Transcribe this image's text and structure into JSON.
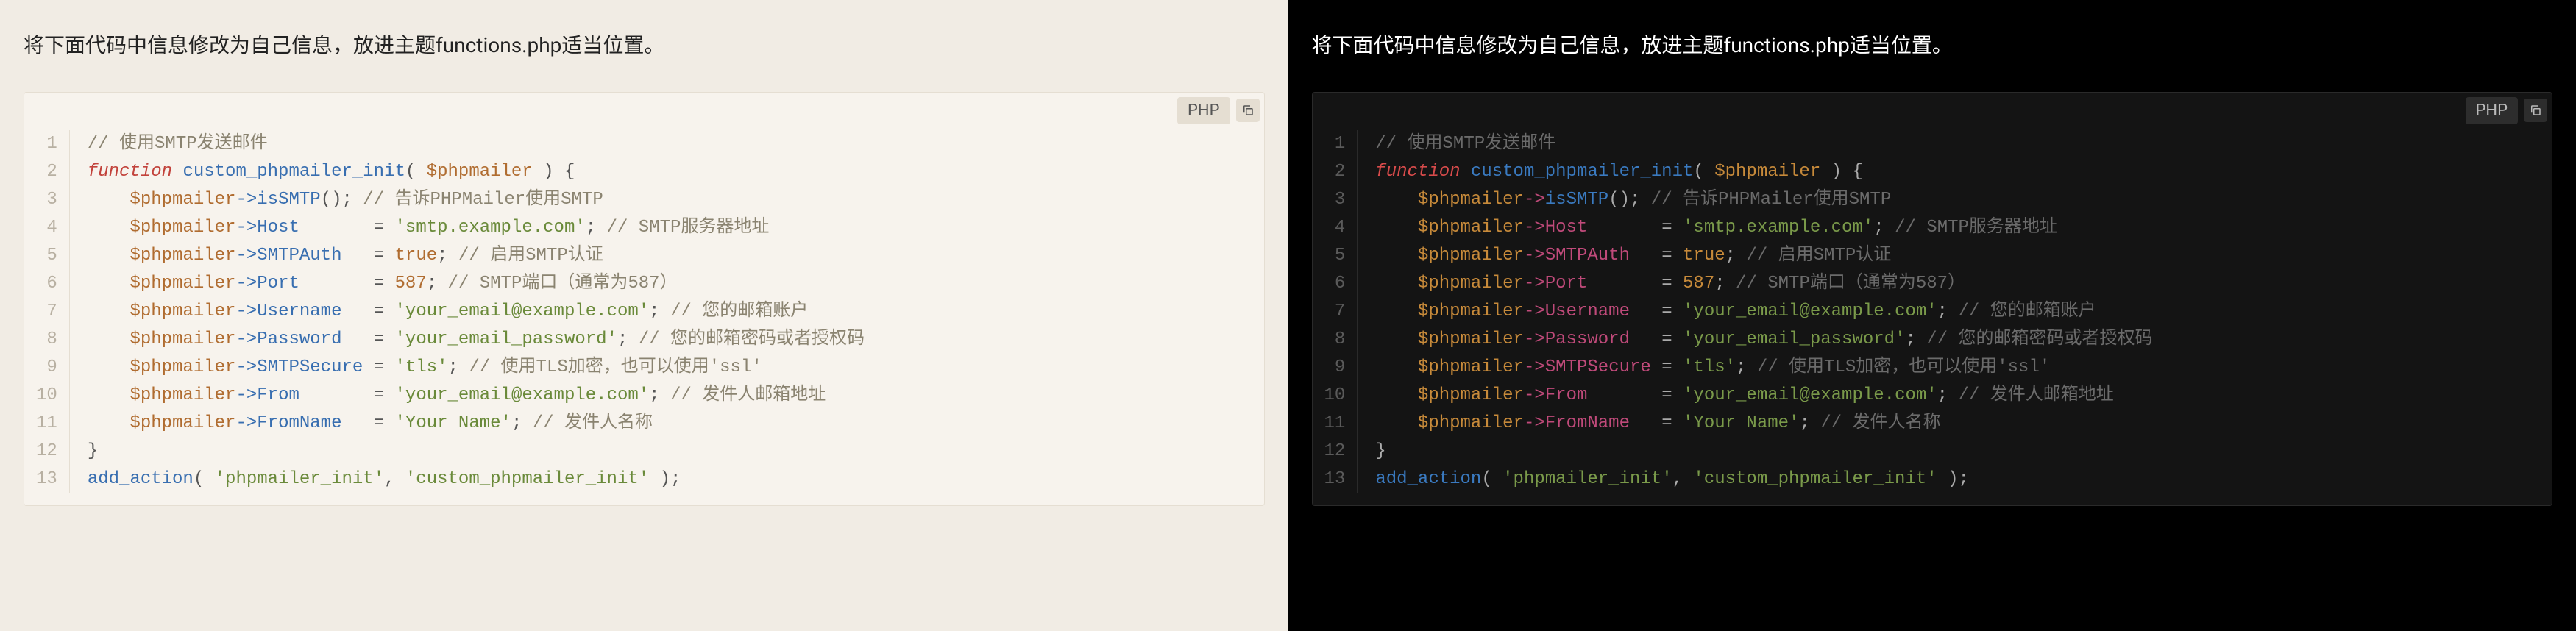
{
  "instruction": "将下面代码中信息修改为自己信息，放进主题functions.php适当位置。",
  "language_badge": "PHP",
  "copy_label": "copy",
  "code": {
    "line_count": 13,
    "tokens": [
      [
        {
          "t": "// 使用SMTP发送邮件",
          "c": "c-comment"
        }
      ],
      [
        {
          "t": "function",
          "c": "c-keyword"
        },
        {
          "t": " "
        },
        {
          "t": "custom_phpmailer_init",
          "c": "c-funcdef"
        },
        {
          "t": "( ",
          "c": "c-punct"
        },
        {
          "t": "$phpmailer",
          "c": "c-var"
        },
        {
          "t": " ) {",
          "c": "c-punct"
        }
      ],
      [
        {
          "t": "    "
        },
        {
          "t": "$phpmailer",
          "c": "c-var"
        },
        {
          "t": "->",
          "c": "c-arrow"
        },
        {
          "t": "isSMTP",
          "c": "c-funccall"
        },
        {
          "t": "(); ",
          "c": "c-punct"
        },
        {
          "t": "// 告诉PHPMailer使用SMTP",
          "c": "c-comment"
        }
      ],
      [
        {
          "t": "    "
        },
        {
          "t": "$phpmailer",
          "c": "c-var"
        },
        {
          "t": "->",
          "c": "c-arrow"
        },
        {
          "t": "Host",
          "c": "c-prop"
        },
        {
          "t": "       "
        },
        {
          "t": "=",
          "c": "c-op"
        },
        {
          "t": " "
        },
        {
          "t": "'smtp.example.com'",
          "c": "c-string"
        },
        {
          "t": "; ",
          "c": "c-punct"
        },
        {
          "t": "// SMTP服务器地址",
          "c": "c-comment"
        }
      ],
      [
        {
          "t": "    "
        },
        {
          "t": "$phpmailer",
          "c": "c-var"
        },
        {
          "t": "->",
          "c": "c-arrow"
        },
        {
          "t": "SMTPAuth",
          "c": "c-prop"
        },
        {
          "t": "   "
        },
        {
          "t": "=",
          "c": "c-op"
        },
        {
          "t": " "
        },
        {
          "t": "true",
          "c": "c-literal"
        },
        {
          "t": "; ",
          "c": "c-punct"
        },
        {
          "t": "// 启用SMTP认证",
          "c": "c-comment"
        }
      ],
      [
        {
          "t": "    "
        },
        {
          "t": "$phpmailer",
          "c": "c-var"
        },
        {
          "t": "->",
          "c": "c-arrow"
        },
        {
          "t": "Port",
          "c": "c-prop"
        },
        {
          "t": "       "
        },
        {
          "t": "=",
          "c": "c-op"
        },
        {
          "t": " "
        },
        {
          "t": "587",
          "c": "c-literal"
        },
        {
          "t": "; ",
          "c": "c-punct"
        },
        {
          "t": "// SMTP端口（通常为587）",
          "c": "c-comment"
        }
      ],
      [
        {
          "t": "    "
        },
        {
          "t": "$phpmailer",
          "c": "c-var"
        },
        {
          "t": "->",
          "c": "c-arrow"
        },
        {
          "t": "Username",
          "c": "c-prop"
        },
        {
          "t": "   "
        },
        {
          "t": "=",
          "c": "c-op"
        },
        {
          "t": " "
        },
        {
          "t": "'your_email@example.com'",
          "c": "c-string"
        },
        {
          "t": "; ",
          "c": "c-punct"
        },
        {
          "t": "// 您的邮箱账户",
          "c": "c-comment"
        }
      ],
      [
        {
          "t": "    "
        },
        {
          "t": "$phpmailer",
          "c": "c-var"
        },
        {
          "t": "->",
          "c": "c-arrow"
        },
        {
          "t": "Password",
          "c": "c-prop"
        },
        {
          "t": "   "
        },
        {
          "t": "=",
          "c": "c-op"
        },
        {
          "t": " "
        },
        {
          "t": "'your_email_password'",
          "c": "c-string"
        },
        {
          "t": "; ",
          "c": "c-punct"
        },
        {
          "t": "// 您的邮箱密码或者授权码",
          "c": "c-comment"
        }
      ],
      [
        {
          "t": "    "
        },
        {
          "t": "$phpmailer",
          "c": "c-var"
        },
        {
          "t": "->",
          "c": "c-arrow"
        },
        {
          "t": "SMTPSecure",
          "c": "c-prop"
        },
        {
          "t": " "
        },
        {
          "t": "=",
          "c": "c-op"
        },
        {
          "t": " "
        },
        {
          "t": "'tls'",
          "c": "c-string"
        },
        {
          "t": "; ",
          "c": "c-punct"
        },
        {
          "t": "// 使用TLS加密，也可以使用'ssl'",
          "c": "c-comment"
        }
      ],
      [
        {
          "t": "    "
        },
        {
          "t": "$phpmailer",
          "c": "c-var"
        },
        {
          "t": "->",
          "c": "c-arrow"
        },
        {
          "t": "From",
          "c": "c-prop"
        },
        {
          "t": "       "
        },
        {
          "t": "=",
          "c": "c-op"
        },
        {
          "t": " "
        },
        {
          "t": "'your_email@example.com'",
          "c": "c-string"
        },
        {
          "t": "; ",
          "c": "c-punct"
        },
        {
          "t": "// 发件人邮箱地址",
          "c": "c-comment"
        }
      ],
      [
        {
          "t": "    "
        },
        {
          "t": "$phpmailer",
          "c": "c-var"
        },
        {
          "t": "->",
          "c": "c-arrow"
        },
        {
          "t": "FromName",
          "c": "c-prop"
        },
        {
          "t": "   "
        },
        {
          "t": "=",
          "c": "c-op"
        },
        {
          "t": " "
        },
        {
          "t": "'Your Name'",
          "c": "c-string"
        },
        {
          "t": "; ",
          "c": "c-punct"
        },
        {
          "t": "// 发件人名称",
          "c": "c-comment"
        }
      ],
      [
        {
          "t": "}",
          "c": "c-punct"
        }
      ],
      [
        {
          "t": "add_action",
          "c": "c-funccall"
        },
        {
          "t": "( ",
          "c": "c-punct"
        },
        {
          "t": "'phpmailer_init'",
          "c": "c-string"
        },
        {
          "t": ", ",
          "c": "c-punct"
        },
        {
          "t": "'custom_phpmailer_init'",
          "c": "c-string"
        },
        {
          "t": " );",
          "c": "c-punct"
        }
      ]
    ]
  }
}
